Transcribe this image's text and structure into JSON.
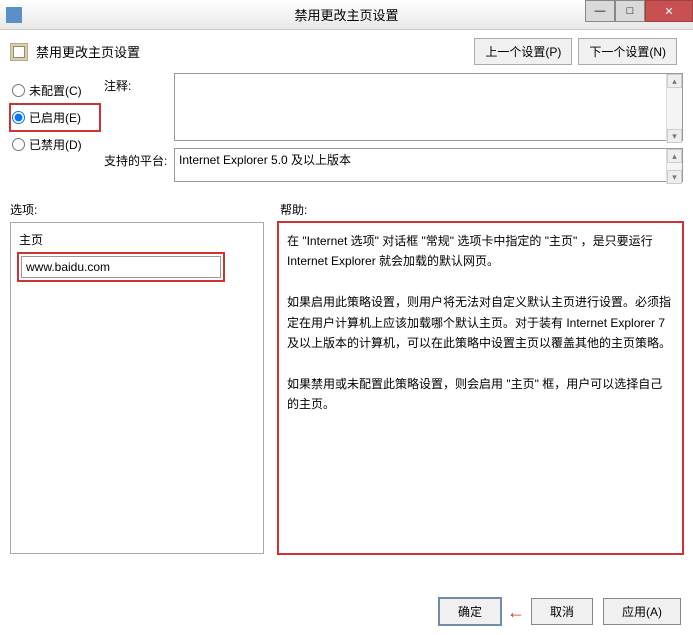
{
  "window": {
    "title": "禁用更改主页设置"
  },
  "header": {
    "title": "禁用更改主页设置",
    "prev_btn": "上一个设置(P)",
    "next_btn": "下一个设置(N)"
  },
  "radios": {
    "not_configured": "未配置(C)",
    "enabled": "已启用(E)",
    "disabled": "已禁用(D)"
  },
  "fields": {
    "comment_label": "注释:",
    "comment_value": "",
    "platform_label": "支持的平台:",
    "platform_value": "Internet Explorer 5.0 及以上版本"
  },
  "section_labels": {
    "options": "选项:",
    "help": "帮助:"
  },
  "options": {
    "homepage_label": "主页",
    "homepage_value": "www.baidu.com"
  },
  "help_text": "在 \"Internet 选项\" 对话框 \"常规\" 选项卡中指定的 \"主页\" ，是只要运行 Internet Explorer 就会加载的默认网页。\n\n如果启用此策略设置，则用户将无法对自定义默认主页进行设置。必须指定在用户计算机上应该加载哪个默认主页。对于装有 Internet Explorer 7 及以上版本的计算机，可以在此策略中设置主页以覆盖其他的主页策略。\n\n如果禁用或未配置此策略设置，则会启用 \"主页\" 框，用户可以选择自己的主页。",
  "buttons": {
    "ok": "确定",
    "cancel": "取消",
    "apply": "应用(A)"
  }
}
